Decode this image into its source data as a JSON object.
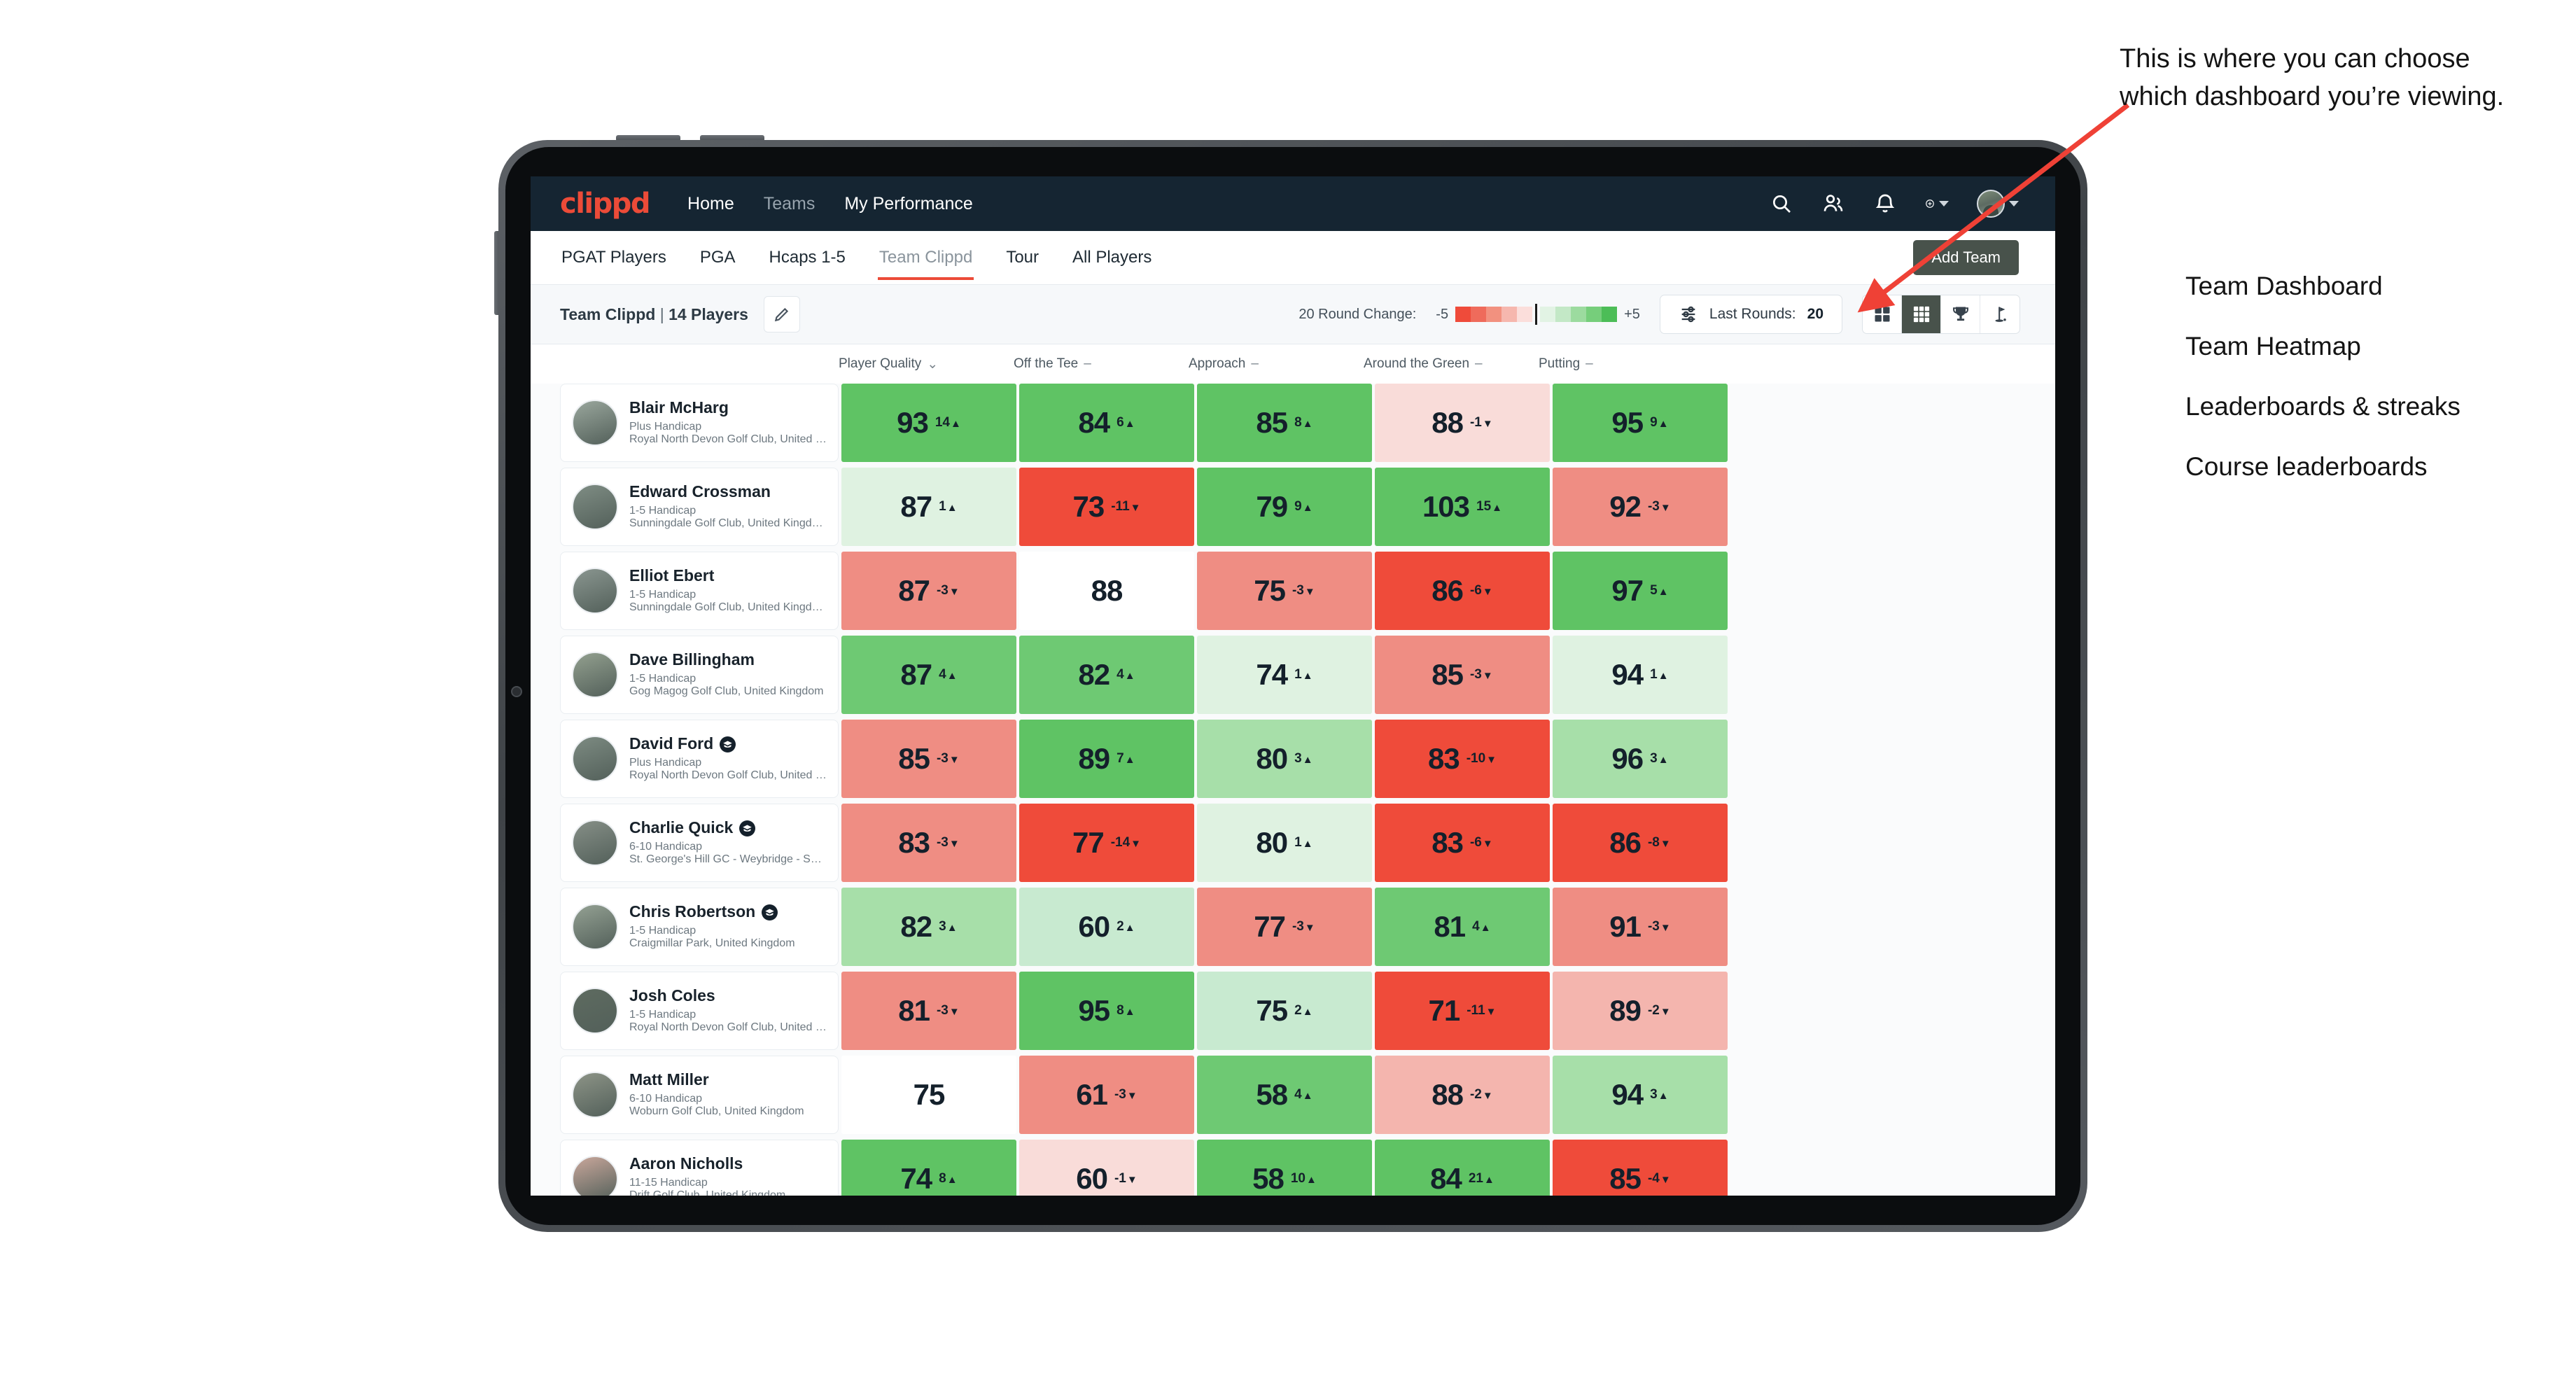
{
  "annotation": {
    "callout": "This is where you can choose which dashboard you’re viewing.",
    "options": [
      "Team Dashboard",
      "Team Heatmap",
      "Leaderboards & streaks",
      "Course leaderboards"
    ]
  },
  "app": {
    "logo": "clippd",
    "nav_links": [
      {
        "label": "Home",
        "active": true
      },
      {
        "label": "Teams",
        "active": false
      },
      {
        "label": "My Performance",
        "active": true
      }
    ],
    "nav_icons": [
      "search-icon",
      "people-icon",
      "bell-icon",
      "plus-circle-icon",
      "avatar"
    ],
    "subtabs": [
      {
        "label": "PGAT Players",
        "active": false
      },
      {
        "label": "PGA",
        "active": false
      },
      {
        "label": "Hcaps 1-5",
        "active": false
      },
      {
        "label": "Team Clippd",
        "active": true
      },
      {
        "label": "Tour",
        "active": false
      },
      {
        "label": "All Players",
        "active": false
      }
    ],
    "add_team_label": "Add Team",
    "toolbar": {
      "team_name": "Team Clippd",
      "team_separator": "|",
      "player_count": "14 Players",
      "edit_icon": "pencil-icon",
      "round_change_label": "20 Round Change:",
      "scale_min": "-5",
      "scale_max": "+5",
      "rounds_button": {
        "icon": "filter-sliders-icon",
        "label": "Last Rounds:",
        "value": "20"
      },
      "views": [
        {
          "name": "team-dashboard",
          "icon": "grid-2x2-icon",
          "active": false
        },
        {
          "name": "team-heatmap",
          "icon": "grid-3x3-icon",
          "active": true
        },
        {
          "name": "leaderboards",
          "icon": "trophy-icon",
          "active": false
        },
        {
          "name": "course-leaderboards",
          "icon": "golf-flag-icon",
          "active": false
        }
      ]
    }
  },
  "colors": {
    "brand_red": "#ec4b38",
    "navbar": "#152532",
    "strong_green": "#5fc364",
    "strong_red": "#ef4b3a",
    "active_dark": "#48524b"
  },
  "chart_data": {
    "type": "heatmap",
    "title": "Team Clippd | 14 Players",
    "columns": [
      {
        "label": "Player Quality",
        "marker": "chevron-down-icon"
      },
      {
        "label": "Off the Tee",
        "marker": "dash"
      },
      {
        "label": "Approach",
        "marker": "dash"
      },
      {
        "label": "Around the Green",
        "marker": "dash"
      },
      {
        "label": "Putting",
        "marker": "dash"
      }
    ],
    "legend": {
      "label": "20 Round Change:",
      "min": -5,
      "max": 5
    },
    "rows": [
      {
        "name": "Blair McHarg",
        "badge": false,
        "handicap": "Plus Handicap",
        "club": "Royal North Devon Golf Club, United Kingdom",
        "values": [
          93,
          84,
          85,
          88,
          95
        ],
        "deltas": [
          "14",
          "6",
          "8",
          "-1",
          "9"
        ],
        "dirs": [
          "up",
          "up",
          "up",
          "down",
          "up"
        ],
        "bg": [
          "#5fc364",
          "#5fc364",
          "#5fc364",
          "#f9dcd9",
          "#5fc364"
        ]
      },
      {
        "name": "Edward Crossman",
        "badge": false,
        "handicap": "1-5 Handicap",
        "club": "Sunningdale Golf Club, United Kingdom",
        "values": [
          87,
          73,
          79,
          103,
          92
        ],
        "deltas": [
          "1",
          "-11",
          "9",
          "15",
          "-3"
        ],
        "dirs": [
          "up",
          "down",
          "up",
          "up",
          "down"
        ],
        "bg": [
          "#dff2e1",
          "#ef4b3a",
          "#5fc364",
          "#5fc364",
          "#ef8d83"
        ]
      },
      {
        "name": "Elliot Ebert",
        "badge": false,
        "handicap": "1-5 Handicap",
        "club": "Sunningdale Golf Club, United Kingdom",
        "values": [
          87,
          88,
          75,
          86,
          97
        ],
        "deltas": [
          "-3",
          "",
          "-3",
          "-6",
          "5"
        ],
        "dirs": [
          "down",
          "",
          "down",
          "down",
          "up"
        ],
        "bg": [
          "#ef8d83",
          "#ffffff",
          "#ef8d83",
          "#ef4b3a",
          "#5fc364"
        ]
      },
      {
        "name": "Dave Billingham",
        "badge": false,
        "handicap": "1-5 Handicap",
        "club": "Gog Magog Golf Club, United Kingdom",
        "values": [
          87,
          82,
          74,
          85,
          94
        ],
        "deltas": [
          "4",
          "4",
          "1",
          "-3",
          "1"
        ],
        "dirs": [
          "up",
          "up",
          "up",
          "down",
          "up"
        ],
        "bg": [
          "#6ec973",
          "#6ec973",
          "#dff2e1",
          "#ef8d83",
          "#dff2e1"
        ]
      },
      {
        "name": "David Ford",
        "badge": true,
        "handicap": "Plus Handicap",
        "club": "Royal North Devon Golf Club, United Kingdom",
        "values": [
          85,
          89,
          80,
          83,
          96
        ],
        "deltas": [
          "-3",
          "7",
          "3",
          "-10",
          "3"
        ],
        "dirs": [
          "down",
          "up",
          "up",
          "down",
          "up"
        ],
        "bg": [
          "#ef8d83",
          "#5fc364",
          "#a7dfa9",
          "#ef4b3a",
          "#a7dfa9"
        ]
      },
      {
        "name": "Charlie Quick",
        "badge": true,
        "handicap": "6-10 Handicap",
        "club": "St. George's Hill GC - Weybridge - Surrey, Uni...",
        "values": [
          83,
          77,
          80,
          83,
          86
        ],
        "deltas": [
          "-3",
          "-14",
          "1",
          "-6",
          "-8"
        ],
        "dirs": [
          "down",
          "down",
          "up",
          "down",
          "down"
        ],
        "bg": [
          "#ef8d83",
          "#ef4b3a",
          "#dff2e1",
          "#ef4b3a",
          "#ef4b3a"
        ]
      },
      {
        "name": "Chris Robertson",
        "badge": true,
        "handicap": "1-5 Handicap",
        "club": "Craigmillar Park, United Kingdom",
        "values": [
          82,
          60,
          77,
          81,
          91
        ],
        "deltas": [
          "3",
          "2",
          "-3",
          "4",
          "-3"
        ],
        "dirs": [
          "up",
          "up",
          "down",
          "up",
          "down"
        ],
        "bg": [
          "#a7dfa9",
          "#c8ead0",
          "#ef8d83",
          "#6ec973",
          "#ef8d83"
        ]
      },
      {
        "name": "Josh Coles",
        "badge": false,
        "handicap": "1-5 Handicap",
        "club": "Royal North Devon Golf Club, United Kingdom",
        "values": [
          81,
          95,
          75,
          71,
          89
        ],
        "deltas": [
          "-3",
          "8",
          "2",
          "-11",
          "-2"
        ],
        "dirs": [
          "down",
          "up",
          "up",
          "down",
          "down"
        ],
        "bg": [
          "#ef8d83",
          "#5fc364",
          "#c8ead0",
          "#ef4b3a",
          "#f4b5ae"
        ]
      },
      {
        "name": "Matt Miller",
        "badge": false,
        "handicap": "6-10 Handicap",
        "club": "Woburn Golf Club, United Kingdom",
        "values": [
          75,
          61,
          58,
          88,
          94
        ],
        "deltas": [
          "",
          "-3",
          "4",
          "-2",
          "3"
        ],
        "dirs": [
          "",
          "down",
          "up",
          "down",
          "up"
        ],
        "bg": [
          "#ffffff",
          "#ef8d83",
          "#6ec973",
          "#f4b5ae",
          "#a7dfa9"
        ]
      },
      {
        "name": "Aaron Nicholls",
        "badge": false,
        "handicap": "11-15 Handicap",
        "club": "Drift Golf Club, United Kingdom",
        "values": [
          74,
          60,
          58,
          84,
          85
        ],
        "deltas": [
          "8",
          "-1",
          "10",
          "21",
          "-4"
        ],
        "dirs": [
          "up",
          "down",
          "up",
          "up",
          "down"
        ],
        "bg": [
          "#5fc364",
          "#f9dcd9",
          "#5fc364",
          "#5fc364",
          "#ef4b3a"
        ]
      }
    ]
  }
}
